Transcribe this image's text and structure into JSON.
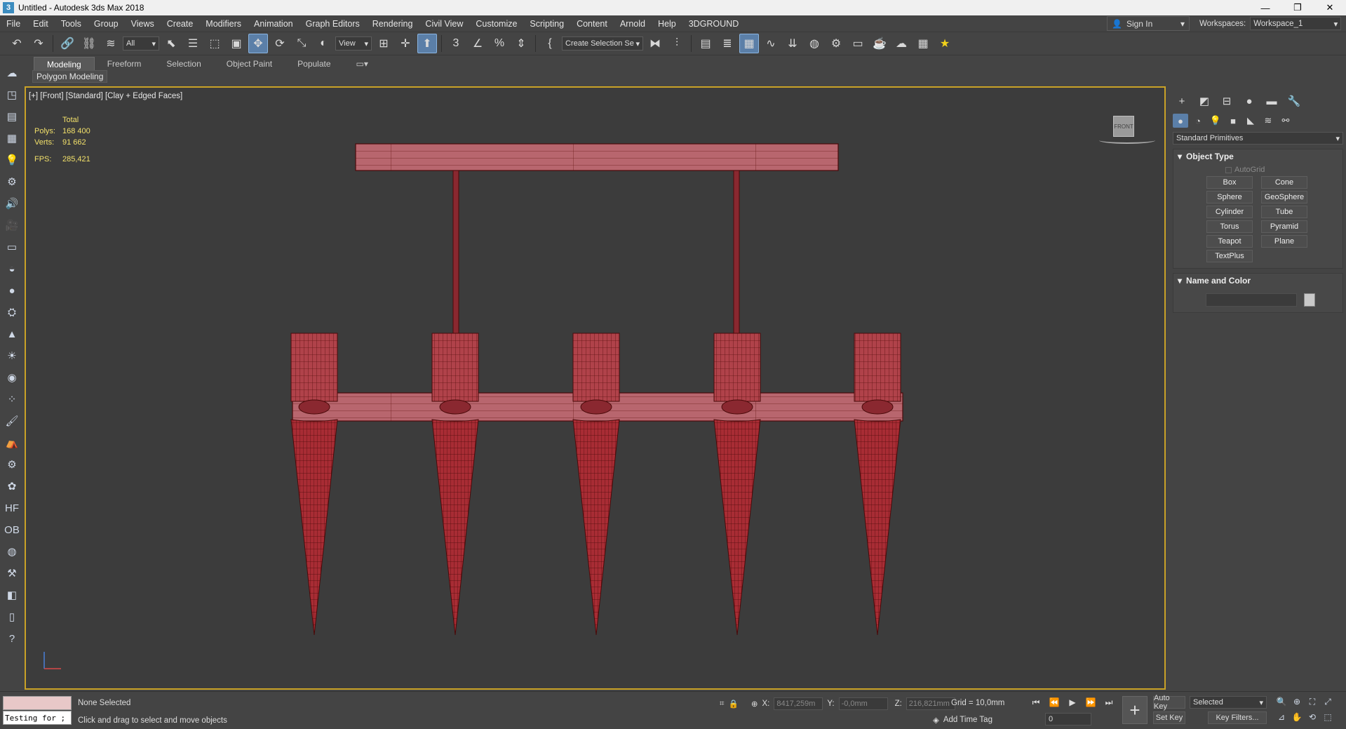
{
  "window": {
    "title": "Untitled - Autodesk 3ds Max 2018",
    "minimize": "—",
    "restore": "❐",
    "close": "✕"
  },
  "menu": {
    "items": [
      "File",
      "Edit",
      "Tools",
      "Group",
      "Views",
      "Create",
      "Modifiers",
      "Animation",
      "Graph Editors",
      "Rendering",
      "Civil View",
      "Customize",
      "Scripting",
      "Content",
      "Arnold",
      "Help",
      "3DGROUND"
    ],
    "sign_in": "Sign In",
    "workspaces_label": "Workspaces:",
    "workspace_value": "Workspace_1"
  },
  "toolbar": {
    "filter_value": "All",
    "ref_coord_value": "View",
    "named_selection_value": "Create Selection Se"
  },
  "ribbon": {
    "tabs": [
      "Modeling",
      "Freeform",
      "Selection",
      "Object Paint",
      "Populate"
    ],
    "active_tab": "Modeling",
    "subtab": "Polygon Modeling"
  },
  "viewport": {
    "label": "[+] [Front] [Standard] [Clay + Edged Faces]",
    "stats_header": "Total",
    "polys_label": "Polys:",
    "polys_value": "168 400",
    "verts_label": "Verts:",
    "verts_value": "91 662",
    "fps_label": "FPS:",
    "fps_value": "285,421",
    "viewcube_label": "FRONT"
  },
  "command_panel": {
    "category": "Standard Primitives",
    "object_type_title": "Object Type",
    "autogrid_label": "AutoGrid",
    "primitives": [
      "Box",
      "Cone",
      "Sphere",
      "GeoSphere",
      "Cylinder",
      "Tube",
      "Torus",
      "Pyramid",
      "Teapot",
      "Plane",
      "TextPlus"
    ],
    "name_color_title": "Name and Color"
  },
  "status": {
    "maxscript_text": "Testing for ;",
    "selection": "None Selected",
    "prompt": "Click and drag to select and move objects",
    "x_label": "X:",
    "x_value": "8417,259m",
    "y_label": "Y:",
    "y_value": "-0,0mm",
    "z_label": "Z:",
    "z_value": "216,821mm",
    "grid": "Grid = 10,0mm",
    "add_time_tag": "Add Time Tag",
    "frame": "0",
    "auto_key": "Auto Key",
    "set_key": "Set Key",
    "selected_dd": "Selected",
    "key_filters": "Key Filters..."
  },
  "colors": {
    "accent": "#5b7fa8",
    "viewport_border": "#c9a227",
    "mesh_fill": "#b25a62",
    "mesh_wire": "#5a1010",
    "stats_text": "#f2e06a"
  }
}
